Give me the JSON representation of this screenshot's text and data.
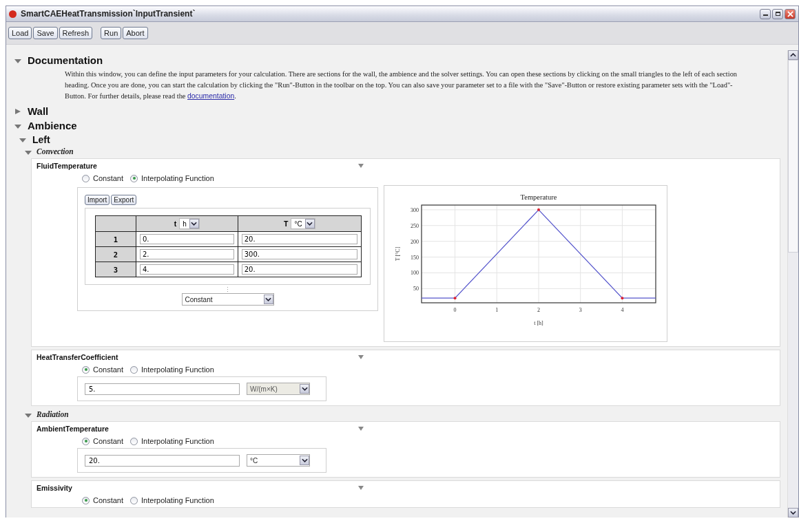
{
  "window": {
    "title": "SmartCAEHeatTransmission`InputTransient`"
  },
  "toolbar": [
    [
      "Load",
      "Save",
      "Refresh"
    ],
    [
      "Run",
      "Abort"
    ]
  ],
  "documentation": {
    "heading": "Documentation",
    "expanded": true,
    "text_before": "Within this window, you can define the input parameters for your calculation. There are sections for the wall, the ambience and the solver settings. You can open these sections by clicking on the small triangles to the left of each section heading. Once you are done, you can start the calculation by clicking the \"Run\"-Button in the toolbar on the top. You can also save your parameter set to a file with the \"Save\"-Button or restore existing parameter sets with the \"Load\"-Button. For further details, please read the ",
    "link": "documentation",
    "text_after": "."
  },
  "wall": {
    "heading": "Wall",
    "expanded": false
  },
  "ambience": {
    "heading": "Ambience",
    "expanded": true
  },
  "left": {
    "heading": "Left",
    "expanded": true
  },
  "groups": [
    {
      "heading": "Convection",
      "expanded": true,
      "parameters": [
        {
          "name": "FluidTemperature",
          "kind": "table",
          "options": [
            {
              "label": "Constant",
              "selected": false
            },
            {
              "label": "Interpolating Function",
              "selected": true
            }
          ],
          "buttons": [
            "Import",
            "Export"
          ],
          "columns": [
            {
              "name": "t",
              "unit": "h"
            },
            {
              "name": "T",
              "unit": "°C"
            }
          ],
          "rows": [
            {
              "index": "1",
              "values": [
                "0.",
                "20."
              ]
            },
            {
              "index": "2",
              "values": [
                "2.",
                "300."
              ]
            },
            {
              "index": "3",
              "values": [
                "4.",
                "20."
              ]
            }
          ],
          "ellipsis": "⋮",
          "extrapolation": "Constant",
          "chart_data": {
            "type": "line",
            "title": "Temperature",
            "xlabel": "t [h]",
            "ylabel": "T [°C]",
            "x": [
              -0.8,
              0,
              2,
              4,
              4.8
            ],
            "grid": true,
            "series": [
              {
                "color": "#5555cc",
                "values": [
                  20,
                  20,
                  300,
                  20,
                  20
                ]
              }
            ],
            "xlim": [
              -0.8,
              4.8
            ],
            "ylim": [
              5,
              315
            ],
            "xticks": [
              0,
              1,
              2,
              3,
              4
            ],
            "yticks": [
              50,
              100,
              150,
              200,
              250,
              300
            ]
          }
        },
        {
          "name": "HeatTransferCoefficient",
          "kind": "constant",
          "options": [
            {
              "label": "Constant",
              "selected": true
            },
            {
              "label": "Interpolating Function",
              "selected": false
            }
          ],
          "value": "5.",
          "unit": "W/(m×K)",
          "unit_disabled": true
        }
      ]
    },
    {
      "heading": "Radiation",
      "expanded": true,
      "parameters": [
        {
          "name": "AmbientTemperature",
          "kind": "constant",
          "options": [
            {
              "label": "Constant",
              "selected": true
            },
            {
              "label": "Interpolating Function",
              "selected": false
            }
          ],
          "value": "20.",
          "unit": "°C",
          "unit_disabled": false
        },
        {
          "name": "Emissivity",
          "kind": "cut",
          "options": [
            {
              "label": "Constant",
              "selected": true
            },
            {
              "label": "Interpolating Function",
              "selected": false
            }
          ]
        }
      ]
    }
  ]
}
